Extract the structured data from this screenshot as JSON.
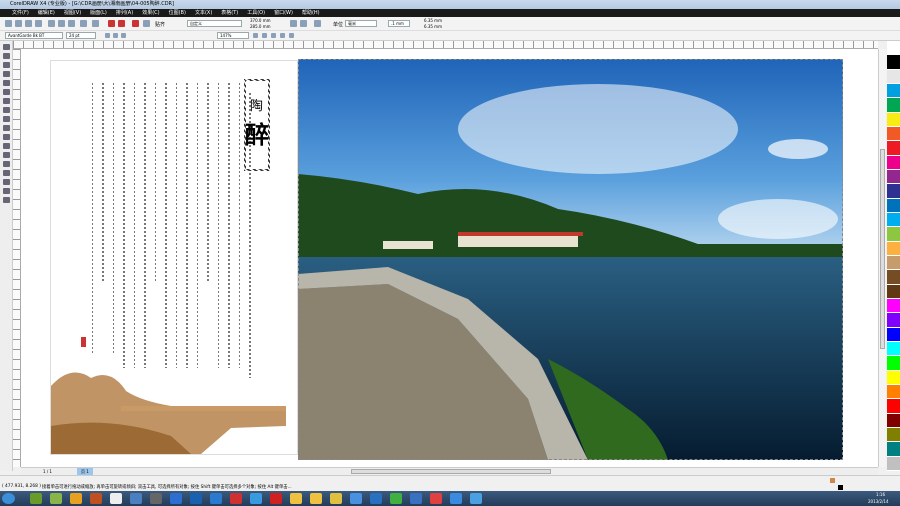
{
  "window": {
    "title": "CorelDRAW X4 (专业版) - [G:\\CDR画册\\大\\湘南画册\\04-005陶醉.CDR]"
  },
  "menu": [
    "文件(F)",
    "编辑(E)",
    "视图(V)",
    "版面(L)",
    "排列(A)",
    "效果(C)",
    "位图(B)",
    "文本(X)",
    "表格(T)",
    "工具(O)",
    "窗口(W)",
    "帮助(H)"
  ],
  "toolbar": {
    "snap_label": "贴齐",
    "page_size": "自定义",
    "width": "370.0 mm",
    "height": "285.0 mm",
    "units_label": "单位",
    "units": "毫米",
    "nudge": ".1 mm",
    "dup_x": "6.35 mm",
    "dup_y": "6.35 mm"
  },
  "propbar": {
    "font": "AvantGarde Bk BT",
    "font_size": "24 pt",
    "zoom": "147%"
  },
  "document": {
    "heading_top": "陶",
    "heading_main": "醉"
  },
  "pagebar": {
    "page_counter": "1 / 1",
    "page_tab": "页 1"
  },
  "status": {
    "coords": "( 477.931, 8.268 )",
    "hint": "接着单击可进行拖动或缩放; 再单击可旋转或倾斜; 双击工具, 可选择所有对象; 按住 Shift 键单击可选择多个对象; 按住 Alt 键单击..."
  },
  "taskbar": {
    "time": "1:16",
    "date": "2013/2/14"
  },
  "palette": [
    "#ffffff",
    "#000000",
    "#e6e6e6",
    "#00a0e0",
    "#00a651",
    "#f7ec13",
    "#f15a24",
    "#ed1c24",
    "#ec008c",
    "#92278f",
    "#2e3192",
    "#0072bc",
    "#00aeef",
    "#8dc63f",
    "#fbb040",
    "#c69c6d",
    "#754c24",
    "#603913",
    "#ff00ff",
    "#7f00ff",
    "#0000ff",
    "#00ffff",
    "#00ff00",
    "#ffff00",
    "#ff8000",
    "#ff0000",
    "#800000",
    "#808000",
    "#008080",
    "#c0c0c0"
  ]
}
